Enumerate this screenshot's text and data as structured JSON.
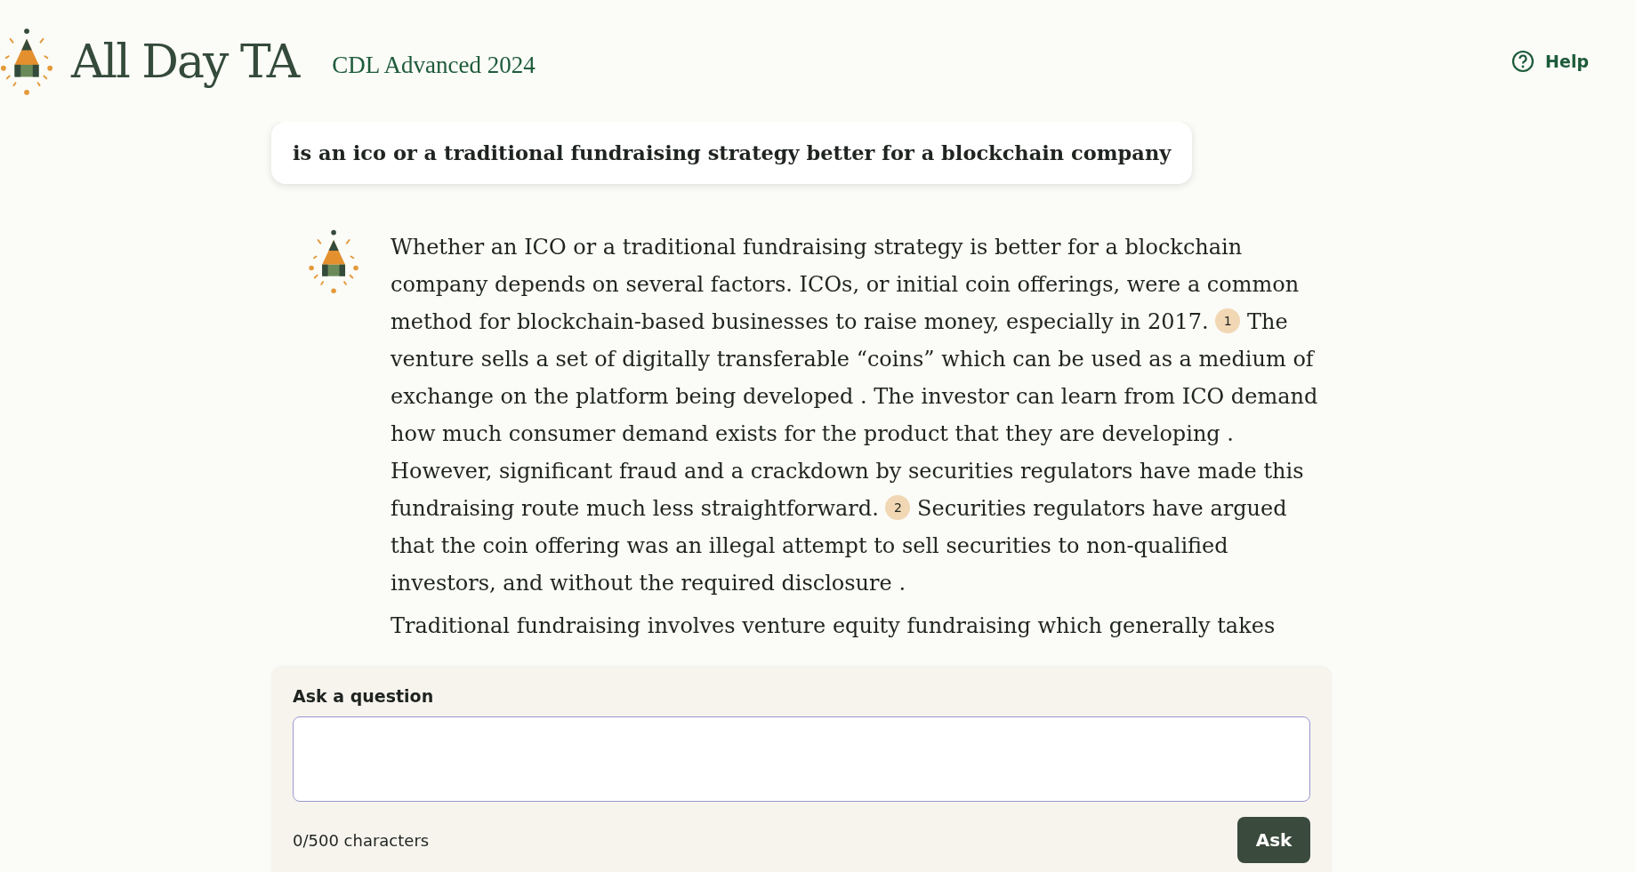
{
  "header": {
    "title": "All Day TA",
    "course": "CDL Advanced 2024",
    "help": "Help"
  },
  "question": "is an ico or a traditional fundraising strategy better for a blockchain company",
  "answer": {
    "paragraphs": [
      {
        "parts": [
          {
            "kind": "text",
            "text": "Whether an ICO or a traditional fundraising strategy is better for a blockchain company depends on several factors. ICOs, or initial coin offerings, were a common method for blockchain-based businesses to raise money, especially in 2017. "
          },
          {
            "kind": "citation",
            "text": "1"
          },
          {
            "kind": "text",
            "text": " The venture sells a set of digitally transferable “coins” which can be used as a medium of exchange on the platform being developed . The investor can learn from ICO demand how much consumer demand exists for the product that they are developing . However, significant fraud and a crackdown by securities regulators have made this fundraising route much less straightforward. "
          },
          {
            "kind": "citation",
            "text": "2"
          },
          {
            "kind": "text",
            "text": " Securities regulators have argued that the coin offering was an illegal attempt to sell securities to non-qualified investors, and without the required disclosure ."
          }
        ]
      },
      {
        "parts": [
          {
            "kind": "text",
            "text": "Traditional fundraising involves venture equity fundraising which generally takes"
          }
        ]
      }
    ]
  },
  "ask": {
    "label": "Ask a question",
    "counter": "0/500 characters",
    "button": "Ask"
  }
}
